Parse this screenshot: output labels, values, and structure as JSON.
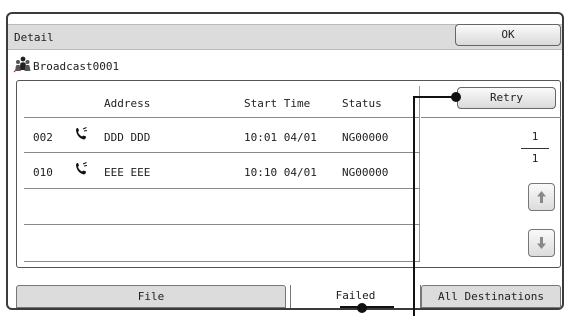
{
  "header": {
    "title": "Detail",
    "ok_label": "OK"
  },
  "broadcast": {
    "icon": "multi-user-icon",
    "name": "Broadcast0001"
  },
  "table": {
    "columns": [
      "Address",
      "Start Time",
      "Status"
    ],
    "rows": [
      {
        "num": "002",
        "icon": "phone-icon",
        "address": "DDD DDD",
        "start_time": "10:01 04/01",
        "status": "NG00000"
      },
      {
        "num": "010",
        "icon": "phone-icon",
        "address": "EEE EEE",
        "start_time": "10:10 04/01",
        "status": "NG00000"
      }
    ]
  },
  "sidebar": {
    "retry_label": "Retry",
    "page_current": "1",
    "page_total": "1",
    "scroll_up_icon": "arrow-up-icon",
    "scroll_down_icon": "arrow-down-icon"
  },
  "tabs": [
    {
      "label": "File"
    },
    {
      "label": "Failed"
    },
    {
      "label": "All Destinations"
    }
  ]
}
